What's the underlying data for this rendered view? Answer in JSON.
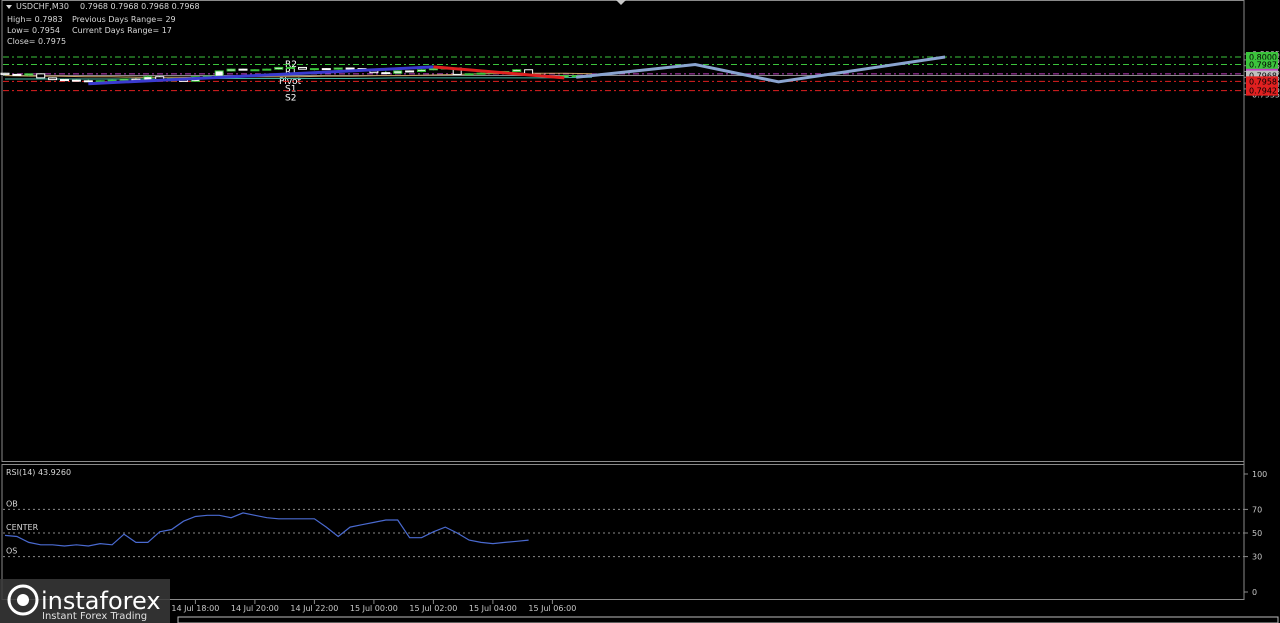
{
  "header": {
    "symbol": "USDCHF,M30",
    "ohlc": "0.7968 0.7968 0.7968 0.7968",
    "high": "High= 0.7983",
    "low": "Low= 0.7954",
    "close": "Close= 0.7975",
    "prev_range": "Previous Days Range= 29",
    "cur_range": "Current Days Range= 17"
  },
  "colors": {
    "background": "#000000",
    "bull_body": "#ffffff",
    "wick": "#3cc43c",
    "resistance": "#3cc43c",
    "support": "#e02020",
    "pivot": "#c040c0",
    "ma": "#c8a060",
    "ma2": "#40b0a0",
    "rsi_line": "#4a6ad0",
    "uptrend": "#3a3ad0",
    "downtrend": "#e02020",
    "projection": "#8aa4d0"
  },
  "chart_data": [
    {
      "type": "candlestick",
      "title": "USDCHF,M30",
      "ylim": [
        0.793,
        0.801
      ],
      "yticks": [
        "0.8005",
        "0.7995",
        "0.7985",
        "0.7975",
        "0.7965",
        "0.7955",
        "0.7945",
        "0.7935"
      ],
      "levels": [
        {
          "name": "R2",
          "value": 0.8,
          "tag": "0.8000",
          "kind": "resistance"
        },
        {
          "name": "R1",
          "value": 0.7987,
          "tag": "0.7987",
          "kind": "resistance"
        },
        {
          "name": "Pivot",
          "value": 0.7971,
          "tag": "0.7971",
          "kind": "pivot"
        },
        {
          "name": "",
          "value": 0.7968,
          "tag": "0.7968",
          "kind": "current"
        },
        {
          "name": "S1",
          "value": 0.7958,
          "tag": "0.7958",
          "kind": "support"
        },
        {
          "name": "S2",
          "value": 0.7942,
          "tag": "0.7942",
          "kind": "support"
        }
      ],
      "candles": [
        [
          0.7972,
          0.7973,
          0.7968,
          0.797
        ],
        [
          0.797,
          0.7971,
          0.7967,
          0.7969
        ],
        [
          0.7969,
          0.7971,
          0.7967,
          0.7971
        ],
        [
          0.7971,
          0.7971,
          0.7963,
          0.7964
        ],
        [
          0.7964,
          0.7965,
          0.796,
          0.7961
        ],
        [
          0.7961,
          0.7963,
          0.796,
          0.796
        ],
        [
          0.796,
          0.7962,
          0.7959,
          0.7959
        ],
        [
          0.7959,
          0.7961,
          0.7957,
          0.7958
        ],
        [
          0.7958,
          0.796,
          0.7954,
          0.7959
        ],
        [
          0.7959,
          0.7961,
          0.7957,
          0.796
        ],
        [
          0.796,
          0.7963,
          0.7957,
          0.7962
        ],
        [
          0.7962,
          0.7964,
          0.7958,
          0.796
        ],
        [
          0.796,
          0.7969,
          0.7959,
          0.7966
        ],
        [
          0.7966,
          0.7968,
          0.7958,
          0.7959
        ],
        [
          0.7959,
          0.7964,
          0.7958,
          0.7963
        ],
        [
          0.7963,
          0.7964,
          0.7958,
          0.7958
        ],
        [
          0.7958,
          0.7966,
          0.7958,
          0.7966
        ],
        [
          0.7966,
          0.7968,
          0.7964,
          0.7967
        ],
        [
          0.7967,
          0.7977,
          0.7966,
          0.7976
        ],
        [
          0.7976,
          0.798,
          0.7975,
          0.7979
        ],
        [
          0.7979,
          0.798,
          0.7977,
          0.7978
        ],
        [
          0.7978,
          0.7979,
          0.7976,
          0.7978
        ],
        [
          0.7978,
          0.798,
          0.7977,
          0.7979
        ],
        [
          0.7979,
          0.7983,
          0.7978,
          0.7982
        ],
        [
          0.7982,
          0.7982,
          0.7981,
          0.7982
        ],
        [
          0.7982,
          0.7982,
          0.7979,
          0.7979
        ],
        [
          0.7979,
          0.798,
          0.7977,
          0.798
        ],
        [
          0.798,
          0.7981,
          0.7978,
          0.7979
        ],
        [
          0.7979,
          0.7981,
          0.7978,
          0.7981
        ],
        [
          0.7981,
          0.7981,
          0.7978,
          0.798
        ],
        [
          0.798,
          0.7981,
          0.7975,
          0.7976
        ],
        [
          0.7976,
          0.7977,
          0.7973,
          0.7973
        ],
        [
          0.7973,
          0.7976,
          0.7972,
          0.7972
        ],
        [
          0.7972,
          0.7977,
          0.7971,
          0.7976
        ],
        [
          0.7976,
          0.7977,
          0.7974,
          0.7975
        ],
        [
          0.7975,
          0.7979,
          0.7974,
          0.7978
        ],
        [
          0.7978,
          0.7981,
          0.7977,
          0.798
        ],
        [
          0.798,
          0.7982,
          0.7979,
          0.7981
        ],
        [
          0.7981,
          0.7981,
          0.7969,
          0.797
        ],
        [
          0.797,
          0.7972,
          0.7969,
          0.7971
        ],
        [
          0.7971,
          0.7973,
          0.797,
          0.7972
        ],
        [
          0.7972,
          0.7975,
          0.7972,
          0.7974
        ],
        [
          0.7974,
          0.7976,
          0.7973,
          0.7975
        ],
        [
          0.7975,
          0.7979,
          0.7974,
          0.7978
        ],
        [
          0.7978,
          0.7978,
          0.7969,
          0.7969
        ],
        [
          0.7969,
          0.7971,
          0.7967,
          0.7967
        ],
        [
          0.7967,
          0.7968,
          0.7965,
          0.7966
        ],
        [
          0.7966,
          0.7968,
          0.7965,
          0.7968
        ],
        [
          0.7968,
          0.7969,
          0.7966,
          0.7968
        ]
      ],
      "ma_slow": [
        0.7968,
        0.7967,
        0.7967,
        0.7966,
        0.7966,
        0.7965,
        0.7965,
        0.7965,
        0.7965,
        0.7966,
        0.7966,
        0.7966,
        0.7967,
        0.7967,
        0.7968,
        0.7968,
        0.7969,
        0.797,
        0.7971,
        0.7972,
        0.7972,
        0.7972,
        0.7971
      ],
      "ma_fast": [
        0.7962,
        0.7962,
        0.7962,
        0.7962,
        0.7963,
        0.7963,
        0.7963,
        0.7963,
        0.7964,
        0.7964,
        0.7964,
        0.7964,
        0.7965
      ],
      "uptrend": [
        [
          7,
          0.7954
        ],
        [
          36,
          0.7983
        ]
      ],
      "downtrend": [
        [
          36,
          0.7983
        ],
        [
          47,
          0.7964
        ]
      ],
      "projection": [
        [
          48,
          0.7965
        ],
        [
          58,
          0.7987
        ],
        [
          65,
          0.7957
        ],
        [
          79,
          0.8
        ]
      ],
      "x_ticks": [
        {
          "label": "14 Jul 18:00",
          "index": 16
        },
        {
          "label": "14 Jul 20:00",
          "index": 21
        },
        {
          "label": "14 Jul 22:00",
          "index": 26
        },
        {
          "label": "15 Jul 00:00",
          "index": 31
        },
        {
          "label": "15 Jul 02:00",
          "index": 36
        },
        {
          "label": "15 Jul 04:00",
          "index": 41
        },
        {
          "label": "15 Jul 06:00",
          "index": 46
        }
      ]
    },
    {
      "type": "line",
      "title": "RSI(14) 43.9260",
      "ylim": [
        0,
        100
      ],
      "yticks": [
        "100",
        "70",
        "50",
        "30",
        "0"
      ],
      "levels": [
        {
          "name": "OB",
          "value": 70
        },
        {
          "name": "CENTER",
          "value": 50
        },
        {
          "name": "OS",
          "value": 30
        }
      ],
      "values": [
        48,
        47,
        42,
        40,
        40,
        39,
        40,
        39,
        41,
        40,
        49,
        42,
        42,
        51,
        53,
        60,
        64,
        65,
        65,
        63,
        67,
        65,
        63,
        62,
        62,
        62,
        62,
        55,
        47,
        55,
        57,
        59,
        61,
        61,
        46,
        46,
        51,
        55,
        50,
        44,
        42,
        41,
        42,
        43,
        44
      ]
    }
  ],
  "watermark": {
    "brand": "instaforex",
    "tagline": "Instant Forex Trading"
  }
}
